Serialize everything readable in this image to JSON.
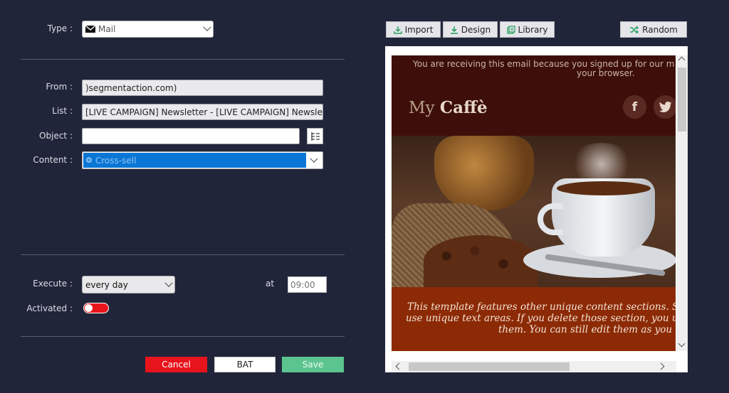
{
  "form": {
    "type_label": "Type :",
    "type_value": "Mail",
    "from_label": "From :",
    "from_value": ")segmentaction.com)",
    "list_label": "List :",
    "list_value": "[LIVE CAMPAIGN] Newsletter - [LIVE CAMPAIGN] Newsle",
    "object_label": "Object :",
    "object_value": "",
    "content_label": "Content :",
    "content_value": "Cross-sell",
    "execute_label": "Execute :",
    "execute_value": "every day",
    "at_label": "at",
    "time_placeholder": "09:00",
    "activated_label": "Activated :"
  },
  "buttons": {
    "cancel": "Cancel",
    "bat": "BAT",
    "save": "Save"
  },
  "toolbar": {
    "import": "Import",
    "design": "Design",
    "library": "Library",
    "random": "Random"
  },
  "preview": {
    "notice_line1": "You are receiving this email because you signed up for our m",
    "notice_line2": "your browser.",
    "brand_my": "My",
    "brand_name": "Caffè",
    "body_line1": "This template features other unique content sections. S",
    "body_line2": "use unique text areas. If you delete those section, you u",
    "body_line3": "them. You can still edit them as you"
  },
  "colors": {
    "background": "#21253a",
    "accent_blue": "#0a76d6",
    "cancel_red": "#e8141c",
    "save_green": "#5cc58f",
    "email_header": "#3e0f0a",
    "email_footer": "#8c2a05"
  }
}
